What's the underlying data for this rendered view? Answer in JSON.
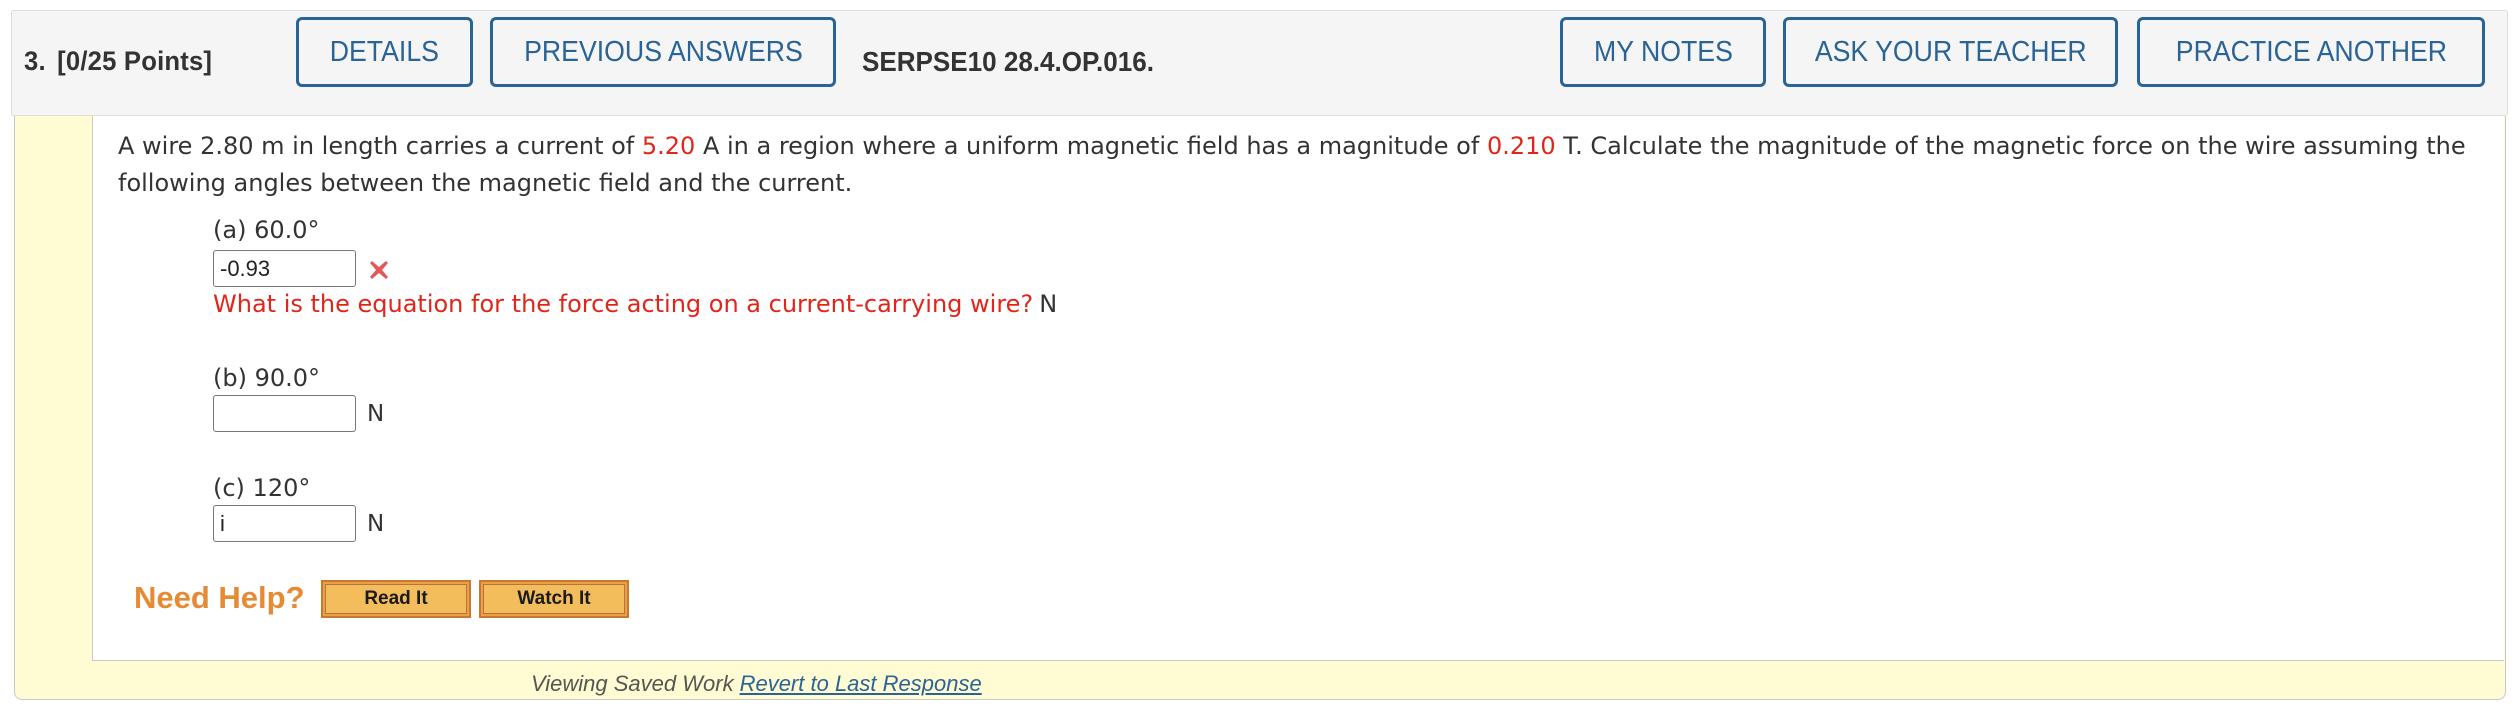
{
  "header": {
    "question_number": "3.",
    "points": "[0/25 Points]",
    "buttons": {
      "details": "DETAILS",
      "previous_answers": "PREVIOUS ANSWERS",
      "my_notes": "MY NOTES",
      "ask_your_teacher": "ASK YOUR TEACHER",
      "practice_another": "PRACTICE ANOTHER"
    },
    "question_id": "SERPSE10 28.4.OP.016."
  },
  "question": {
    "text_1": "A wire 2.80 m in length carries a current of ",
    "current": "5.20",
    "text_2": " A in a region where a uniform magnetic field has a magnitude of ",
    "field": "0.210",
    "text_3": " T. Calculate the magnitude of the magnetic force on the wire assuming the following angles between the magnetic field and the current."
  },
  "parts": [
    {
      "label": "(a) 60.0°",
      "value": "-0.93",
      "status": "incorrect",
      "status_icon": "x-mark-icon",
      "hint": "What is the equation for the force acting on a current-carrying wire?",
      "unit": "N"
    },
    {
      "label": "(b) 90.0°",
      "value": "",
      "unit": "N"
    },
    {
      "label": "(c) 120°",
      "value": "i",
      "unit": "N"
    }
  ],
  "help": {
    "label": "Need Help?",
    "read_it": "Read It",
    "watch_it": "Watch It"
  },
  "footer": {
    "status": "Viewing Saved Work",
    "revert_link": "Revert to Last Response"
  },
  "colors": {
    "accent_blue": "#2a6496",
    "error_red": "#e0261b",
    "help_orange": "#e68a33",
    "panel_yellow": "#fffcd3"
  }
}
